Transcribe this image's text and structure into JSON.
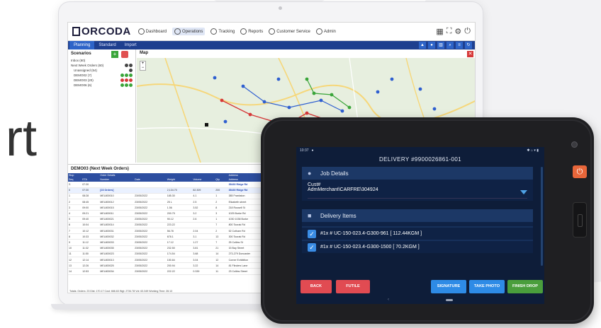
{
  "hero": {
    "partial_text": "rt"
  },
  "colors": {
    "brand_navy": "#1e3f8f",
    "tab_blue": "#2e64c8",
    "tablet_bg": "#0e1d39",
    "btn_red": "#e14b52",
    "btn_blue": "#2e8be6",
    "btn_green": "#4a9e3c"
  },
  "laptop": {
    "logo": "ORCODA",
    "nav": [
      {
        "label": "Dashboard",
        "icon": "dashboard-icon"
      },
      {
        "label": "Operations",
        "icon": "operations-icon",
        "active": true
      },
      {
        "label": "Tracking",
        "icon": "tracking-icon"
      },
      {
        "label": "Reports",
        "icon": "reports-icon"
      },
      {
        "label": "Customer Service",
        "icon": "customer-service-icon"
      },
      {
        "label": "Admin",
        "icon": "admin-icon"
      }
    ],
    "subtabs": [
      "Planning",
      "Standard",
      "Import"
    ],
    "scenarios": {
      "title": "Scenarios",
      "rows": [
        "Inbox (60)",
        "Next Week Orders (60)",
        "Unassigned (54)",
        "DEMO02 (7)",
        "DEMO03 (20)",
        "DEMO06 (6)"
      ]
    },
    "map": {
      "title": "Map"
    },
    "orders": {
      "title": "DEMO03 (Next Week Orders)",
      "group_headers": [
        "Stop",
        "Order Details",
        "Address"
      ],
      "columns": [
        "Seq",
        "ETA",
        "Number",
        "Date",
        "Weight",
        "Volume",
        "Qty",
        "Address"
      ],
      "rows": [
        [
          "S",
          "07:30",
          "",
          "",
          "",
          "",
          "",
          "35430 Ridge Rd"
        ],
        [
          "0",
          "07:30",
          "[23 Orders]",
          "",
          "2,134.70",
          "82.309",
          "200",
          "35430 Ridge Rd"
        ],
        [
          "1",
          "08:28",
          "MEL800010",
          "23/05/2022",
          "185.30",
          "4.1",
          "1",
          "385 Frankston"
        ],
        [
          "2",
          "08:45",
          "MEL800012",
          "23/05/2022",
          "25 L",
          "2.5",
          "2",
          "Elizabeth street"
        ],
        [
          "3",
          "09:00",
          "MEL800015",
          "23/05/2022",
          "1.56",
          "3.52",
          "8",
          "218 Russell St"
        ],
        [
          "4",
          "09:21",
          "MEL800011",
          "23/05/2022",
          "200.75",
          "3.2",
          "3",
          "1025 Burke Rd"
        ],
        [
          "5",
          "09:40",
          "MEL800021",
          "23/05/2022",
          "90.12",
          "2.6",
          "1",
          "1030 1038 Burke"
        ],
        [
          "6",
          "10:04",
          "MEL800014",
          "23/05/2022",
          "223.22",
          "",
          "7",
          "800 Toorak Rd"
        ],
        [
          "7",
          "10:12",
          "MEL800031",
          "23/05/2022",
          "56.78",
          "2.04",
          "2",
          "52 Cotham Rd"
        ],
        [
          "8",
          "10:33",
          "MEL800032",
          "23/05/2022",
          "678.1",
          "3.1",
          "13",
          "300 Toorak Rd"
        ],
        [
          "9",
          "11:12",
          "MEL800033",
          "23/05/2022",
          "17.12",
          "1.27",
          "7",
          "25 Collins St"
        ],
        [
          "10",
          "11:32",
          "MEL800035",
          "23/05/2022",
          "232.50",
          "3.81",
          "21",
          "15 Bay Street"
        ],
        [
          "11",
          "11:50",
          "MEL800023",
          "23/05/2022",
          "174.54",
          "3.68",
          "14",
          "273-279 Doncaster"
        ],
        [
          "12",
          "12:14",
          "MEL800013",
          "23/05/2022",
          "150.84",
          "3.04",
          "12",
          "Corner Exhibition"
        ],
        [
          "13",
          "12:26",
          "MEL800025",
          "23/05/2022",
          "200.94",
          "3.22",
          "14",
          "81 Flinders Lane"
        ],
        [
          "14",
          "12:53",
          "MEL800034",
          "23/05/2022",
          "222.22",
          "0.339",
          "11",
          "23 Collins Street"
        ]
      ],
      "totals": "Totals: Orders: 23 Dist: 170.17 Cost: 666.63 Wgt: 2734.78 Vol: 63.349 Working Time: 26:13"
    }
  },
  "tablet": {
    "status_time": "10:37",
    "title": "DELIVERY #9900026861-001",
    "job_details": {
      "heading": "Job Details",
      "field_label": "Cust#",
      "field_value": "AdmMerchant\\CARFRE\\304924"
    },
    "delivery_items": {
      "heading": "Delivery Items",
      "items": [
        "#1x # UC-150-023.4-G300-961 [ 112.44KGM ]",
        "#1x # UC-150-023.4-G300-1500 [ 70.2KGM ]"
      ]
    },
    "buttons": {
      "back": "BACK",
      "futile": "FUTILE",
      "signature": "SIGNATURE",
      "take_photo": "TAKE PHOTO",
      "finish_drop": "FINISH DROP"
    }
  }
}
